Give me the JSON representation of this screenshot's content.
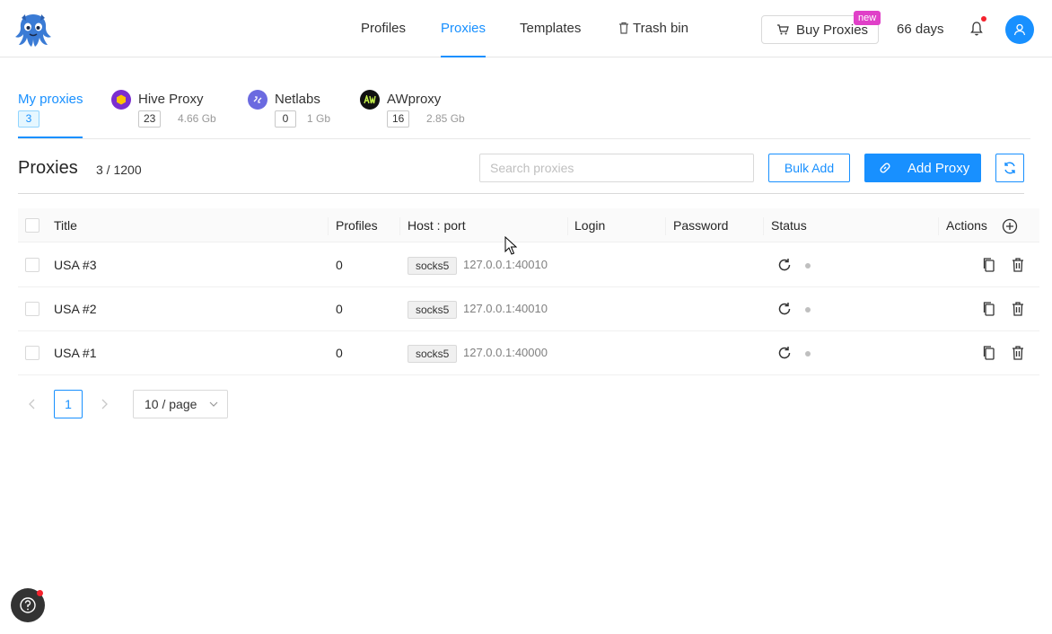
{
  "nav": {
    "items": [
      {
        "label": "Profiles"
      },
      {
        "label": "Proxies"
      },
      {
        "label": "Templates"
      },
      {
        "label": "Trash bin"
      }
    ],
    "buy_label": "Buy Proxies",
    "new_badge": "new",
    "days": "66 days"
  },
  "providers": [
    {
      "name": "My proxies",
      "count": "3",
      "size": ""
    },
    {
      "name": "Hive Proxy",
      "count": "23",
      "size": "4.66 Gb"
    },
    {
      "name": "Netlabs",
      "count": "0",
      "size": "1 Gb"
    },
    {
      "name": "AWproxy",
      "count": "16",
      "size": "2.85 Gb"
    }
  ],
  "toolbar": {
    "title": "Proxies",
    "count": "3 / 1200",
    "search_placeholder": "Search proxies",
    "bulk_label": "Bulk Add",
    "add_label": "Add Proxy"
  },
  "table": {
    "headers": {
      "title": "Title",
      "profiles": "Profiles",
      "host": "Host : port",
      "login": "Login",
      "password": "Password",
      "status": "Status",
      "actions": "Actions"
    },
    "rows": [
      {
        "title": "USA #3",
        "profiles": "0",
        "protocol": "socks5",
        "host": "127.0.0.1:40010"
      },
      {
        "title": "USA #2",
        "profiles": "0",
        "protocol": "socks5",
        "host": "127.0.0.1:40010"
      },
      {
        "title": "USA #1",
        "profiles": "0",
        "protocol": "socks5",
        "host": "127.0.0.1:40000"
      }
    ]
  },
  "pagination": {
    "current": "1",
    "page_size": "10 / page"
  },
  "colors": {
    "accent": "#1890ff",
    "badge": "#e040c8",
    "notify": "#f5222d"
  }
}
